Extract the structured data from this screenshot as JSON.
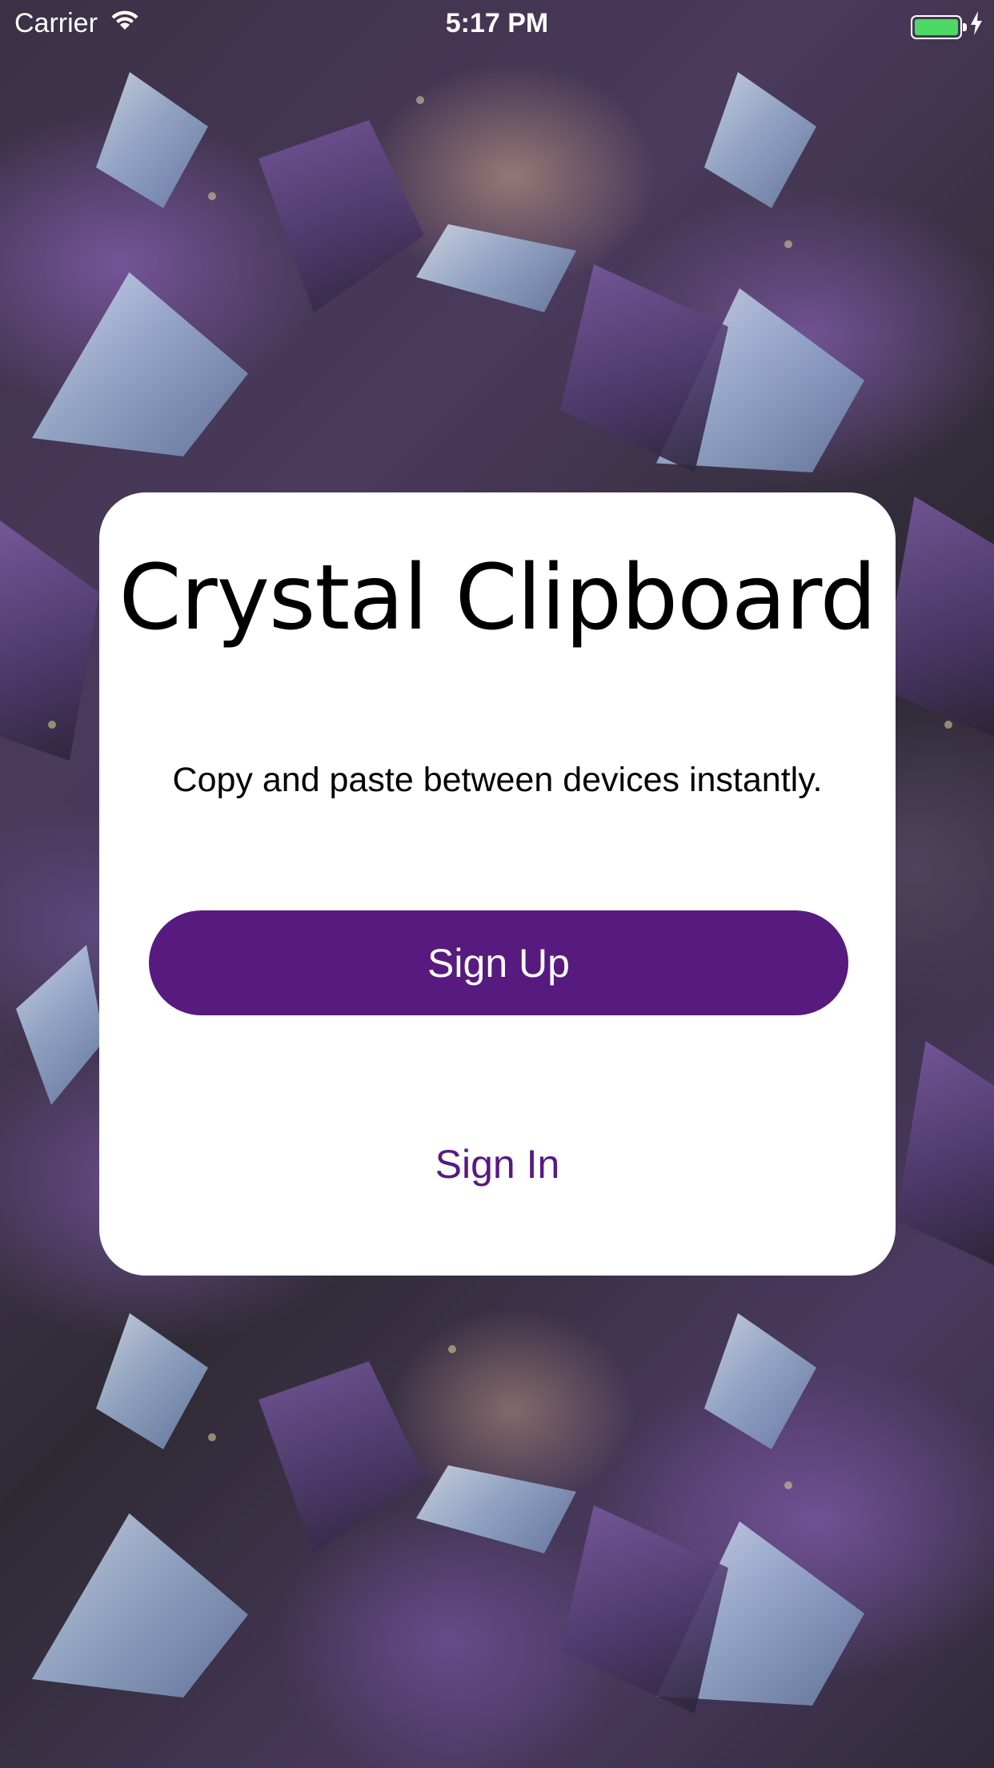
{
  "status_bar": {
    "carrier": "Carrier",
    "time": "5:17 PM",
    "battery_color": "#4cd964"
  },
  "card": {
    "title": "Crystal Clipboard",
    "subtitle": "Copy and paste between devices instantly.",
    "primary_button": "Sign Up",
    "secondary_button": "Sign In"
  },
  "colors": {
    "accent": "#571a7f",
    "card_background": "#ffffff"
  },
  "icons": {
    "wifi": "wifi-icon",
    "charging": "charging-bolt-icon",
    "battery": "battery-icon"
  }
}
